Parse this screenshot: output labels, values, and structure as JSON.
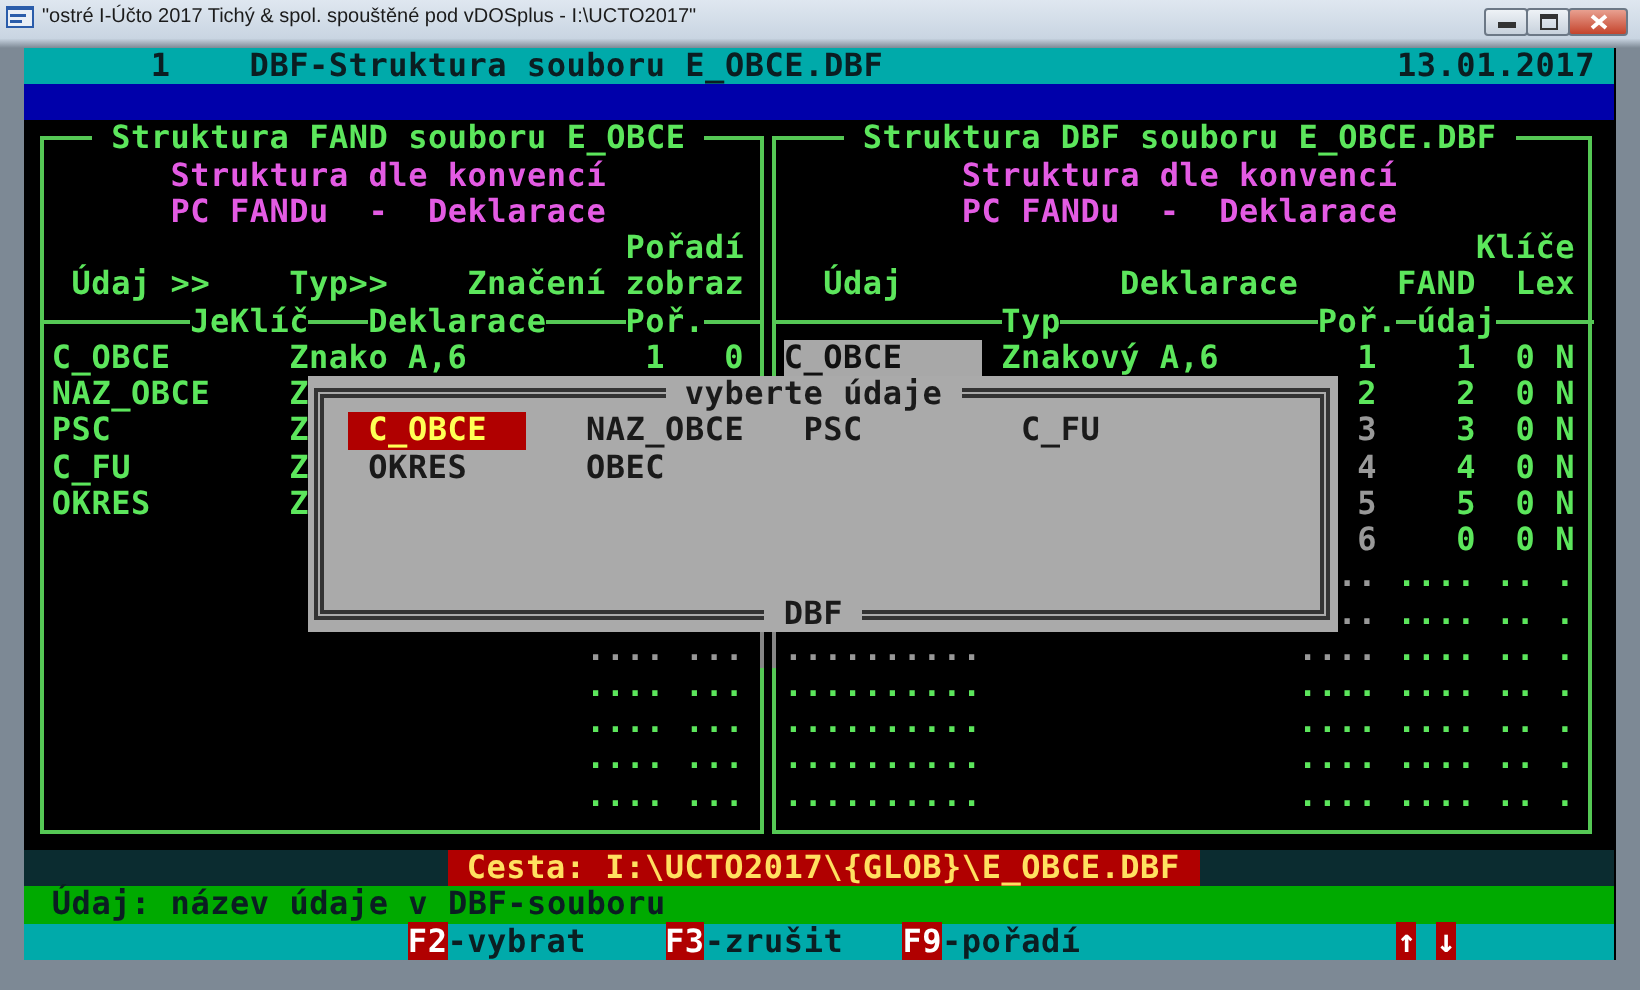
{
  "window": {
    "title": "\"ostré I-Účto 2017 Tichý & spol. spouštěné pod vDOSplus - I:\\UCTO2017\""
  },
  "header": {
    "number": "1",
    "title": "DBF-Struktura souboru E_OBCE.DBF",
    "date": "13.01.2017"
  },
  "left_panel": {
    "title": "Struktura FAND souboru E_OBCE",
    "subtitle": [
      "Struktura dle konvencí",
      "PC FANDu  -  Deklarace"
    ],
    "headers": [
      "Pořadí",
      "Údaj >>",
      "Typ>>",
      "Značení",
      "zobraz"
    ],
    "separator_labels": [
      "JeKlíč",
      "Deklarace",
      "Poř."
    ],
    "rows": [
      {
        "name": "C_OBCE",
        "type": "Znako A,6",
        "order": "1",
        "key": "0"
      },
      {
        "name": "NAZ_OBCE",
        "type": "Z"
      },
      {
        "name": "PSC",
        "type": "Z"
      },
      {
        "name": "C_FU",
        "type": "Z"
      },
      {
        "name": "OKRES",
        "type": "Z"
      }
    ],
    "blank_rows": [
      {
        "order": "....",
        "key": "..."
      },
      {
        "order": "....",
        "key": "..."
      },
      {
        "order": "....",
        "key": "..."
      },
      {
        "order": "....",
        "key": "..."
      },
      {
        "order": "....",
        "key": "..."
      }
    ]
  },
  "right_panel": {
    "title": "Struktura DBF souboru E_OBCE.DBF",
    "subtitle": [
      "Struktura dle konvencí",
      "PC FANDu  -  Deklarace"
    ],
    "headers": [
      "Klíče",
      "Údaj",
      "Deklarace",
      "FAND",
      "Lex"
    ],
    "separator_labels": [
      "Typ",
      "Poř.",
      "údaj"
    ],
    "rows": [
      {
        "name": "C_OBCE",
        "selected": true,
        "type": "Znakový A,6",
        "order": "1",
        "fand": "1",
        "key": "0",
        "lex": "N"
      },
      {
        "order": "2",
        "fand": "2",
        "key": "0",
        "lex": "N"
      },
      {
        "order": "3",
        "fand": "3",
        "key": "0",
        "lex": "N"
      },
      {
        "order": "4",
        "fand": "4",
        "key": "0",
        "lex": "N"
      },
      {
        "order": "5",
        "fand": "5",
        "key": "0",
        "lex": "N"
      },
      {
        "order": "6",
        "fand": "0",
        "key": "0",
        "lex": "N"
      },
      {
        "order": "..",
        "fand": "....",
        "key": "..",
        "lex": "."
      },
      {
        "order": "..",
        "fand": "....",
        "key": "..",
        "lex": "."
      },
      {
        "selected": false,
        "name": "..........",
        "order": "....",
        "fand": "....",
        "key": "..",
        "lex": "."
      },
      {
        "selected": false,
        "name": "..........",
        "order": "....",
        "fand": "....",
        "key": "..",
        "lex": "."
      },
      {
        "selected": false,
        "name": "..........",
        "order": "....",
        "fand": "....",
        "key": "..",
        "lex": "."
      },
      {
        "selected": false,
        "name": "..........",
        "order": "....",
        "fand": "....",
        "key": "..",
        "lex": "."
      },
      {
        "selected": false,
        "name": "..........",
        "order": "....",
        "fand": "....",
        "key": "..",
        "lex": "."
      }
    ]
  },
  "popup": {
    "title": "vyberte údaje",
    "footer": "DBF",
    "items": [
      {
        "label": "C_OBCE",
        "selected": true
      },
      {
        "label": "NAZ_OBCE",
        "selected": false
      },
      {
        "label": "PSC",
        "selected": false
      },
      {
        "label": "C_FU",
        "selected": false
      },
      {
        "label": "OKRES",
        "selected": false
      },
      {
        "label": "OBEC",
        "selected": false
      }
    ]
  },
  "path": "Cesta: I:\\UCTO2017\\{GLOB}\\E_OBCE.DBF",
  "status": "Údaj: název údaje v DBF-souboru",
  "hotkeys": [
    {
      "key": "F2",
      "label": "-vybrat"
    },
    {
      "key": "F3",
      "label": "-zrušit"
    },
    {
      "key": "F9",
      "label": "-pořadí"
    },
    {
      "key": "↑"
    },
    {
      "key": "↓"
    }
  ]
}
